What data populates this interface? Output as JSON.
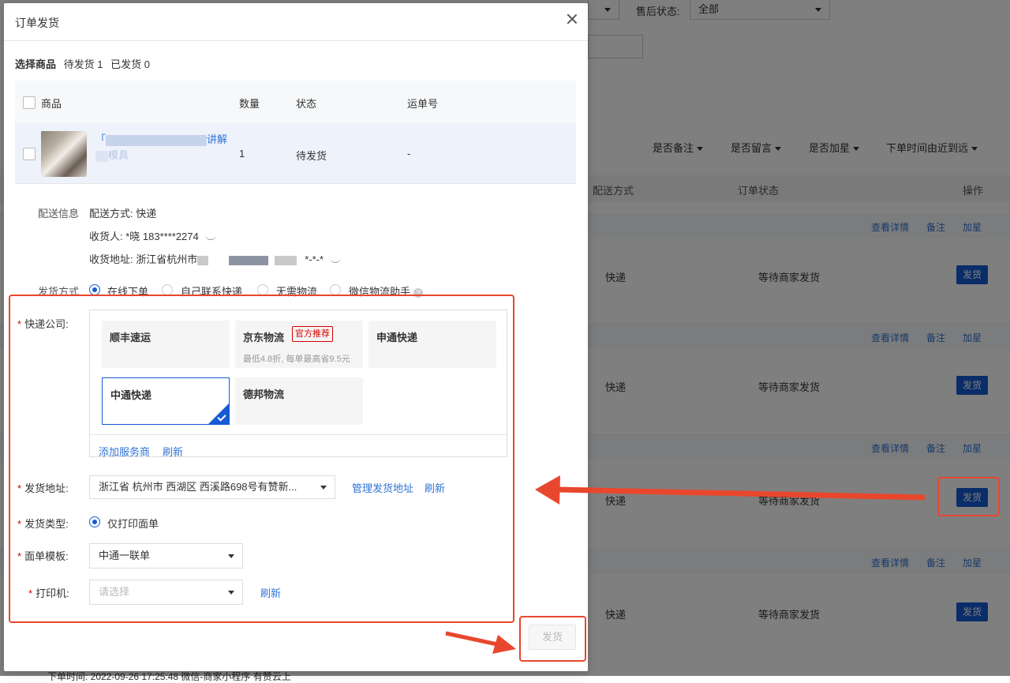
{
  "background": {
    "top_select_value": "",
    "after_sale_label": "售后状态:",
    "after_sale_value": "全部",
    "sort_filters": [
      "是否备注",
      "是否留言",
      "是否加星",
      "下单时间由近到远"
    ],
    "table_headers": {
      "delivery_method": "配送方式",
      "order_status": "订单状态",
      "actions": "操作"
    },
    "row_actions": {
      "view": "查看详情",
      "note": "备注",
      "star": "加星"
    },
    "rows": [
      {
        "delivery": "快递",
        "status": "等待商家发货",
        "button": "发货"
      },
      {
        "delivery": "快递",
        "status": "等待商家发货",
        "button": "发货"
      },
      {
        "delivery": "快递",
        "status": "等待商家发货",
        "button": "发货"
      },
      {
        "delivery": "快递",
        "status": "等待商家发货",
        "button": "发货"
      }
    ],
    "bottom_text": "下单时间: 2022-09-26 17:25:48    微信-商家小程序    有赞云上"
  },
  "dialog": {
    "title": "订单发货",
    "summary": {
      "select_label": "选择商品",
      "pending": "待发货 1",
      "shipped": "已发货 0"
    },
    "goods_table": {
      "headers": {
        "goods": "商品",
        "qty": "数量",
        "status": "状态",
        "tracking": "运单号"
      },
      "row": {
        "name_prefix": "「",
        "name_suffix": "讲解",
        "name_line2_suffix": "模具",
        "qty": "1",
        "status": "待发货",
        "tracking": "-"
      }
    },
    "delivery_info": {
      "label": "配送信息",
      "method": "配送方式: 快递",
      "receiver": "收货人: *晓 183****2274",
      "address_prefix": "收货地址: 浙江省杭州市",
      "address_suffix": "*-*-*"
    },
    "ship_mode": {
      "label": "发货方式",
      "options": [
        "在线下单",
        "自己联系快递",
        "无需物流",
        "微信物流助手"
      ],
      "selected": 0
    },
    "courier": {
      "label": "快递公司:",
      "cards": [
        {
          "name": "顺丰速运",
          "tag": "",
          "note": ""
        },
        {
          "name": "京东物流",
          "tag": "官方推荐",
          "note": "最低4.8折, 每单最高省9.5元"
        },
        {
          "name": "申通快递",
          "tag": "",
          "note": ""
        },
        {
          "name": "中通快递",
          "tag": "",
          "note": ""
        },
        {
          "name": "德邦物流",
          "tag": "",
          "note": ""
        }
      ],
      "selected": 3,
      "add_link": "添加服务商",
      "refresh_link": "刷新"
    },
    "ship_address": {
      "label": "发货地址:",
      "value": "浙江省 杭州市 西湖区 西溪路698号有赞新...",
      "manage_link": "管理发货地址",
      "refresh_link": "刷新"
    },
    "ship_type": {
      "label": "发货类型:",
      "value": "仅打印面单"
    },
    "template": {
      "label": "面单模板:",
      "value": "中通一联单"
    },
    "printer": {
      "label": "打印机:",
      "placeholder": "请选择",
      "refresh_link": "刷新"
    },
    "submit_button": "发货"
  },
  "colors": {
    "primary": "#155bd4",
    "link": "#2e74d6",
    "annotation": "#e8472e",
    "required": "#d40000"
  }
}
